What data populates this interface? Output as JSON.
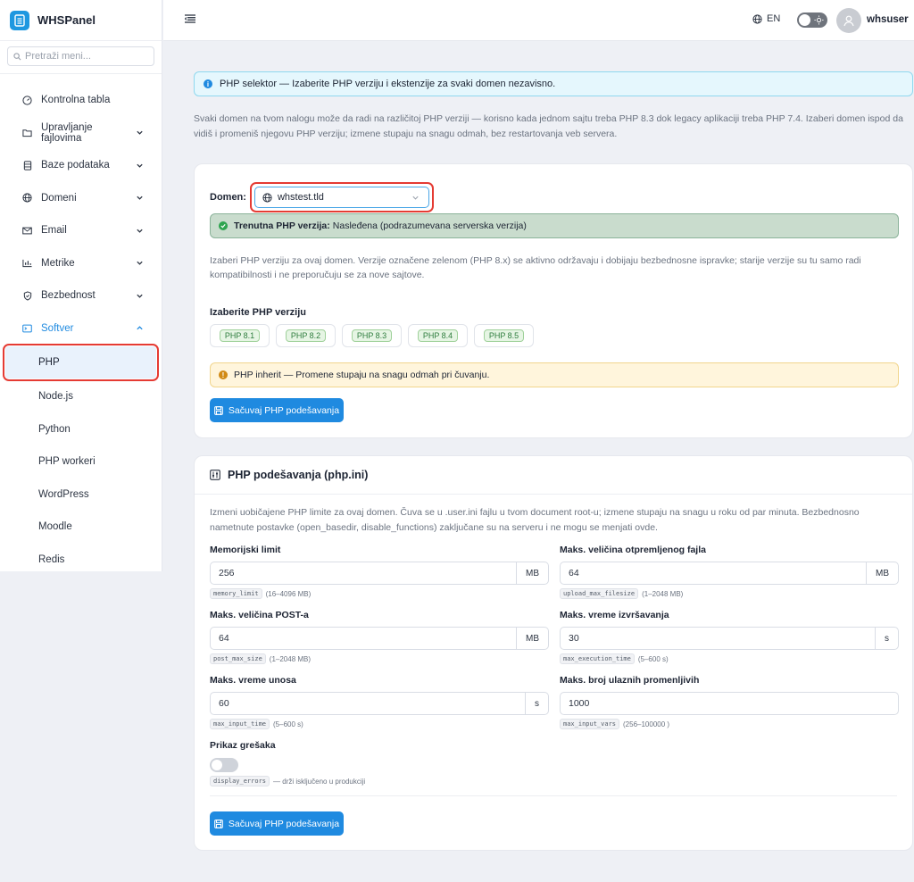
{
  "brand": {
    "name": "WHSPanel"
  },
  "sidebar": {
    "search_placeholder": "Pretraži meni...",
    "items": [
      {
        "label": "Kontrolna tabla",
        "icon": "dashboard-icon",
        "has_chevron": false
      },
      {
        "label": "Upravljanje fajlovima",
        "icon": "folder-icon",
        "has_chevron": true
      },
      {
        "label": "Baze podataka",
        "icon": "database-icon",
        "has_chevron": true
      },
      {
        "label": "Domeni",
        "icon": "globe-icon",
        "has_chevron": true
      },
      {
        "label": "Email",
        "icon": "mail-icon",
        "has_chevron": true
      },
      {
        "label": "Metrike",
        "icon": "chart-icon",
        "has_chevron": true
      },
      {
        "label": "Bezbednost",
        "icon": "shield-icon",
        "has_chevron": true
      },
      {
        "label": "Softver",
        "icon": "terminal-icon",
        "has_chevron": true,
        "expanded": true
      }
    ],
    "subitems": [
      "PHP",
      "Node.js",
      "Python",
      "PHP workeri",
      "WordPress",
      "Moodle",
      "Redis"
    ],
    "active_subitem": "PHP"
  },
  "topbar": {
    "lang": "EN",
    "username": "whsuser"
  },
  "main": {
    "banner": "PHP selektor — Izaberite PHP verziju i ekstenzije za svaki domen nezavisno.",
    "description": "Svaki domen na tvom nalogu može da radi na različitoj PHP verziji — korisno kada jednom sajtu treba PHP 8.3 dok legacy aplikaciji treba PHP 7.4. Izaberi domen ispod da vidiš i promeniš njegovu PHP verziju; izmene stupaju na snagu odmah, bez restartovanja veb servera."
  },
  "card1": {
    "domain_label": "Domen:",
    "domain_value": "whstest.tld",
    "current_label": "Trenutna PHP verzija:",
    "current_value": "Nasleđena (podrazumevana serverska verzija)",
    "description": "Izaberi PHP verziju za ovaj domen. Verzije označene zelenom (PHP 8.x) se aktivno održavaju i dobijaju bezbednosne ispravke; starije verzije su tu samo radi kompatibilnosti i ne preporučuju se za nove sajtove.",
    "choose_label": "Izaberite PHP verziju",
    "versions": [
      "PHP 8.1",
      "PHP 8.2",
      "PHP 8.3",
      "PHP 8.4",
      "PHP 8.5"
    ],
    "warning": "PHP inherit — Promene stupaju na snagu odmah pri čuvanju.",
    "save_label": "Sačuvaj PHP podešavanja"
  },
  "card2": {
    "title": "PHP podešavanja (php.ini)",
    "description": "Izmeni uobičajene PHP limite za ovaj domen. Čuva se u .user.ini fajlu u tvom document root-u; izmene stupaju na snagu u roku od par minuta. Bezbednosno nametnute postavke (open_basedir, disable_functions) zaključane su na serveru i ne mogu se menjati ovde.",
    "fields": {
      "memory": {
        "label": "Memorijski limit",
        "value": "256",
        "unit": "MB",
        "key": "memory_limit",
        "range": "(16–4096 MB)"
      },
      "upload": {
        "label": "Maks. veličina otpremljenog fajla",
        "value": "64",
        "unit": "MB",
        "key": "upload_max_filesize",
        "range": "(1–2048 MB)"
      },
      "post": {
        "label": "Maks. veličina POST-a",
        "value": "64",
        "unit": "MB",
        "key": "post_max_size",
        "range": "(1–2048 MB)"
      },
      "exec": {
        "label": "Maks. vreme izvršavanja",
        "value": "30",
        "unit": "s",
        "key": "max_execution_time",
        "range": "(5–600 s)"
      },
      "input_time": {
        "label": "Maks. vreme unosa",
        "value": "60",
        "unit": "s",
        "key": "max_input_time",
        "range": "(5–600 s)"
      },
      "input_vars": {
        "label": "Maks. broj ulaznih promenljivih",
        "value": "1000",
        "key": "max_input_vars",
        "range": "(256–100000 )"
      }
    },
    "display_errors": {
      "label": "Prikaz grešaka",
      "key": "display_errors",
      "hint": "— drži isključeno u produkciji",
      "enabled": false
    },
    "save_label": "Sačuvaj PHP podešavanja"
  },
  "colors": {
    "accent": "#1f8ae0",
    "highlight": "#e53b33",
    "success": "#2ea44f",
    "warning": "#d18a15"
  }
}
